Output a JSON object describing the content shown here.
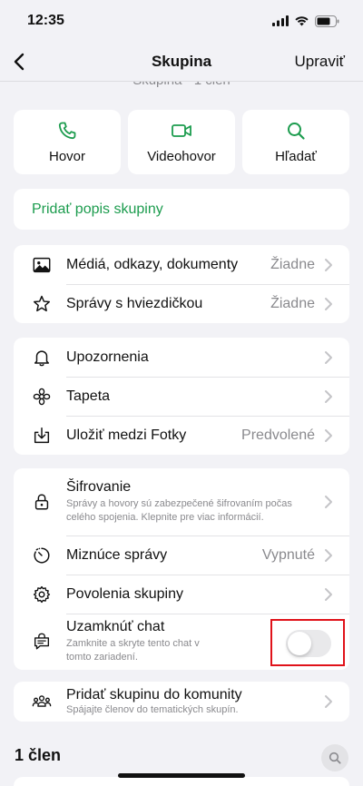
{
  "status_bar": {
    "time": "12:35"
  },
  "nav": {
    "title": "Skupina",
    "edit_label": "Upraviť"
  },
  "header": {
    "subtitle": "Skupina · 1 člen"
  },
  "actions": [
    {
      "label": "Hovor",
      "icon": "phone-icon"
    },
    {
      "label": "Videohovor",
      "icon": "video-icon"
    },
    {
      "label": "Hľadať",
      "icon": "search-icon"
    }
  ],
  "description": {
    "add_label": "Pridať popis skupiny"
  },
  "media_section": [
    {
      "label": "Médiá, odkazy, dokumenty",
      "value": "Žiadne",
      "icon": "photo-icon"
    },
    {
      "label": "Správy s hviezdičkou",
      "value": "Žiadne",
      "icon": "star-icon"
    }
  ],
  "settings_section": [
    {
      "label": "Upozornenia",
      "value": "",
      "icon": "bell-icon"
    },
    {
      "label": "Tapeta",
      "value": "",
      "icon": "flower-icon"
    },
    {
      "label": "Uložiť medzi Fotky",
      "value": "Predvolené",
      "icon": "download-icon"
    }
  ],
  "security_section": {
    "encryption": {
      "label": "Šifrovanie",
      "sub": "Správy a hovory sú zabezpečené šifrovaním počas celého spojenia. Klepnite pre viac informácií.",
      "icon": "lock-icon"
    },
    "disappearing": {
      "label": "Miznúce správy",
      "value": "Vypnuté",
      "icon": "timer-icon"
    },
    "permissions": {
      "label": "Povolenia skupiny",
      "icon": "gear-icon"
    },
    "lock_chat": {
      "label": "Uzamknúť chat",
      "sub": "Zamknite a skryte tento chat v tomto zariadení.",
      "icon": "chat-lock-icon",
      "enabled": false
    }
  },
  "community": {
    "label": "Pridať skupinu do komunity",
    "sub": "Spájajte členov do tematických skupín.",
    "icon": "community-icon"
  },
  "members": {
    "count_label": "1 člen"
  },
  "colors": {
    "accent_green": "#1c9c4e",
    "highlight_red": "#e0121a"
  }
}
